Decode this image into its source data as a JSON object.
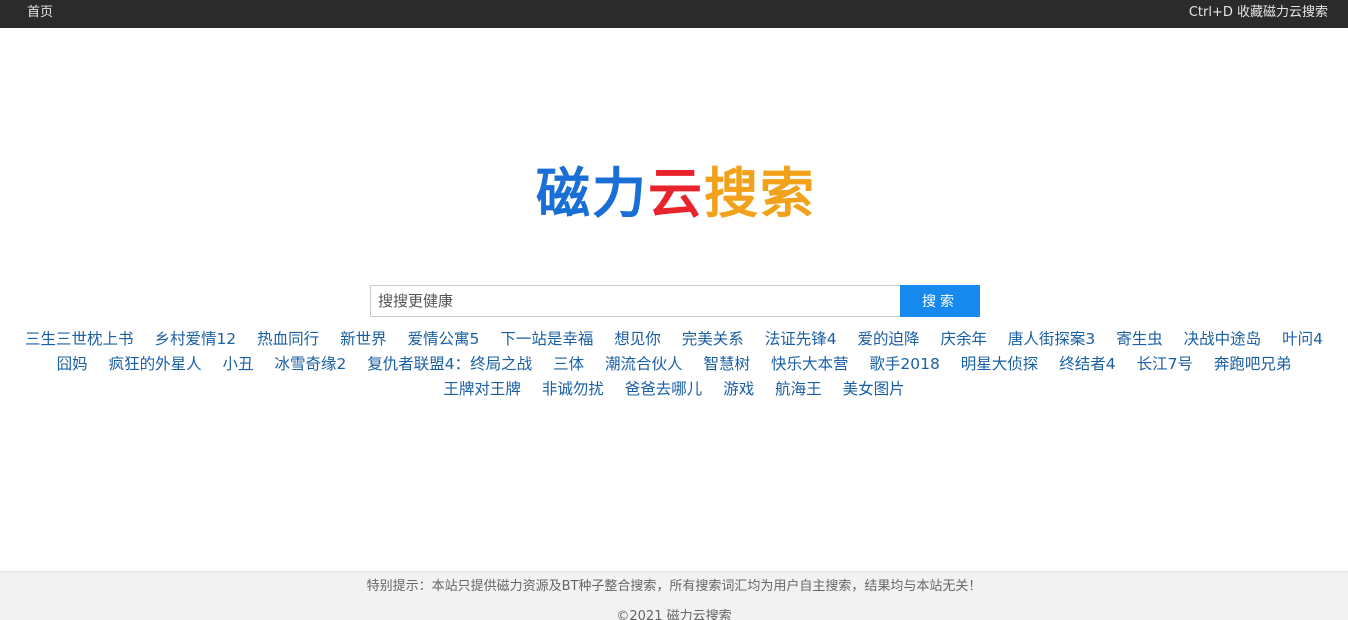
{
  "topbar": {
    "home_label": "首页",
    "bookmark_label": "Ctrl+D 收藏磁力云搜索"
  },
  "logo": {
    "chars": [
      {
        "text": "磁",
        "color": "#1a6fd6"
      },
      {
        "text": "力",
        "color": "#1a6fd6"
      },
      {
        "text": "云",
        "color": "#e8232c"
      },
      {
        "text": "搜",
        "color": "#f2a11a"
      },
      {
        "text": "索",
        "color": "#f2a11a"
      }
    ]
  },
  "search": {
    "placeholder": "搜搜更健康",
    "button_label": "搜索"
  },
  "hot_keywords": [
    "三生三世枕上书",
    "乡村爱情12",
    "热血同行",
    "新世界",
    "爱情公寓5",
    "下一站是幸福",
    "想见你",
    "完美关系",
    "法证先锋4",
    "爱的迫降",
    "庆余年",
    "唐人街探案3",
    "寄生虫",
    "决战中途岛",
    "叶问4",
    "囧妈",
    "疯狂的外星人",
    "小丑",
    "冰雪奇缘2",
    "复仇者联盟4：终局之战",
    "三体",
    "潮流合伙人",
    "智慧树",
    "快乐大本营",
    "歌手2018",
    "明星大侦探",
    "终结者4",
    "长江7号",
    "奔跑吧兄弟",
    "王牌对王牌",
    "非诚勿扰",
    "爸爸去哪儿",
    "游戏",
    "航海王",
    "美女图片"
  ],
  "footer": {
    "tip": "特别提示：本站只提供磁力资源及BT种子整合搜索，所有搜索词汇均为用户自主搜索，结果均与本站无关！",
    "copyright": "©2021 磁力云搜索"
  }
}
